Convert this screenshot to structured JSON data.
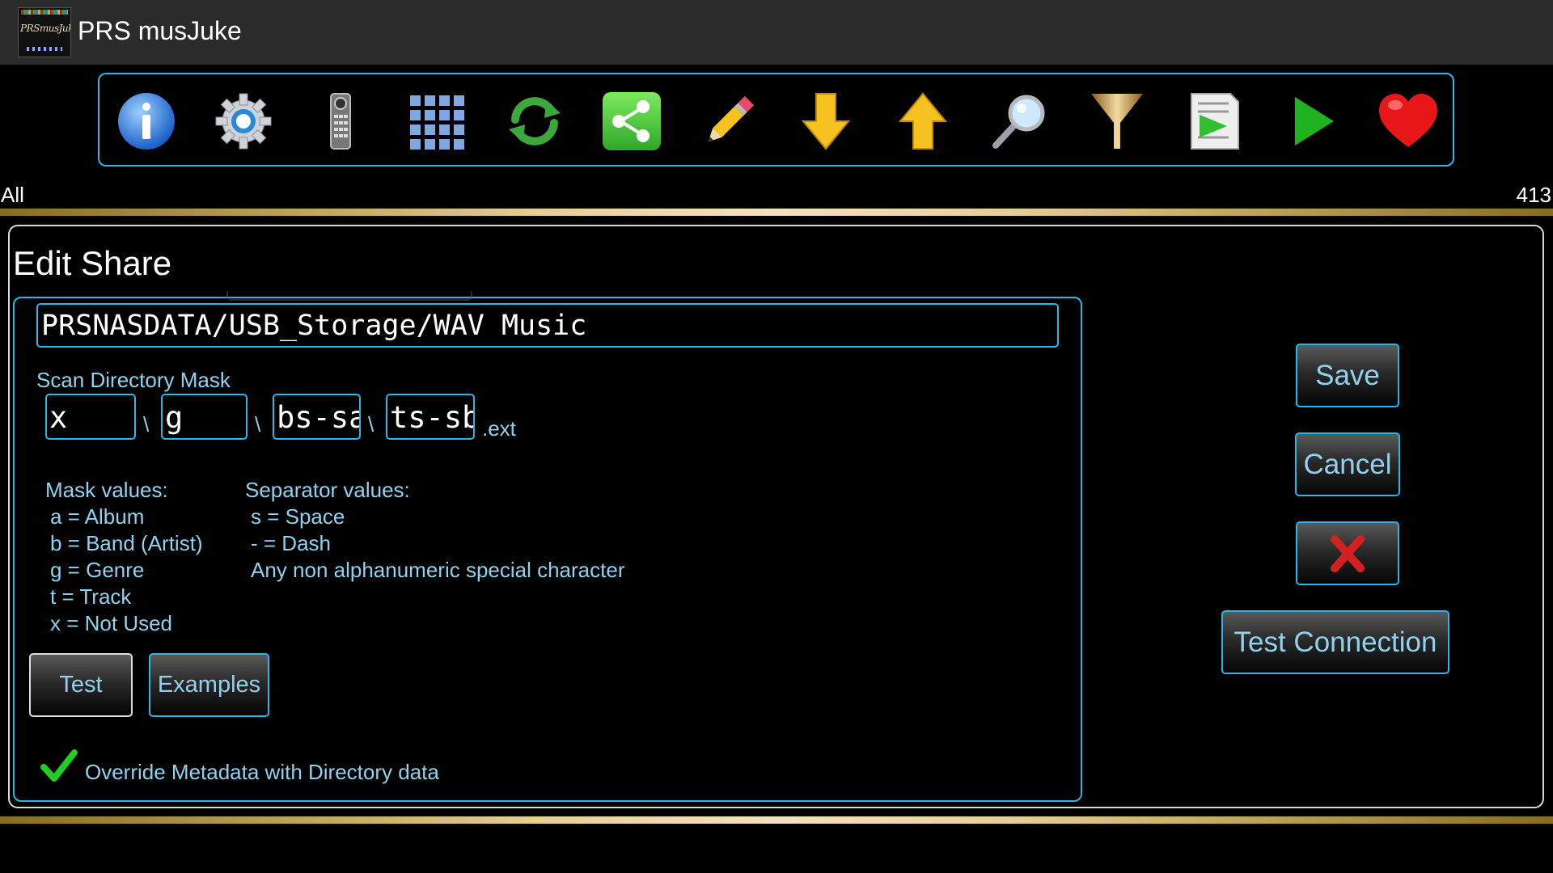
{
  "app": {
    "title": "PRS musJuke",
    "logo_text": "PRSmusJuke"
  },
  "toolbar": {
    "icons": [
      "info-icon",
      "settings-gear-icon",
      "remote-control-icon",
      "grid-icon",
      "refresh-icon",
      "share-icon",
      "pencil-icon",
      "arrow-down-icon",
      "arrow-up-icon",
      "magnifier-icon",
      "filter-funnel-icon",
      "playlist-icon",
      "play-icon",
      "heart-icon"
    ],
    "accent": "#2bb5e8"
  },
  "status": {
    "filter": "All",
    "count": "413"
  },
  "dialog": {
    "title": "Edit Share",
    "path_value": "PRSNASDATA/USB_Storage/WAV Music",
    "scan_mask_label": "Scan Directory Mask",
    "mask_fields": [
      "x",
      "g",
      "bs-sa",
      "ts-sb"
    ],
    "separator": "\\",
    "ext_label": ".ext",
    "mask_values_title": "Mask values:",
    "mask_values": [
      "a = Album",
      "b = Band (Artist)",
      "g = Genre",
      "t = Track",
      "x = Not Used"
    ],
    "separator_values_title": "Separator values:",
    "separator_values": [
      "s = Space",
      "- = Dash",
      "Any non alphanumeric special character"
    ],
    "test_label": "Test",
    "examples_label": "Examples",
    "override_label": "Override Metadata with Directory data",
    "override_checked": true,
    "save_label": "Save",
    "cancel_label": "Cancel",
    "test_connection_label": "Test Connection"
  },
  "colors": {
    "label_blue": "#8fd2f0",
    "check_green": "#22cc22",
    "delete_red": "#d42020"
  }
}
